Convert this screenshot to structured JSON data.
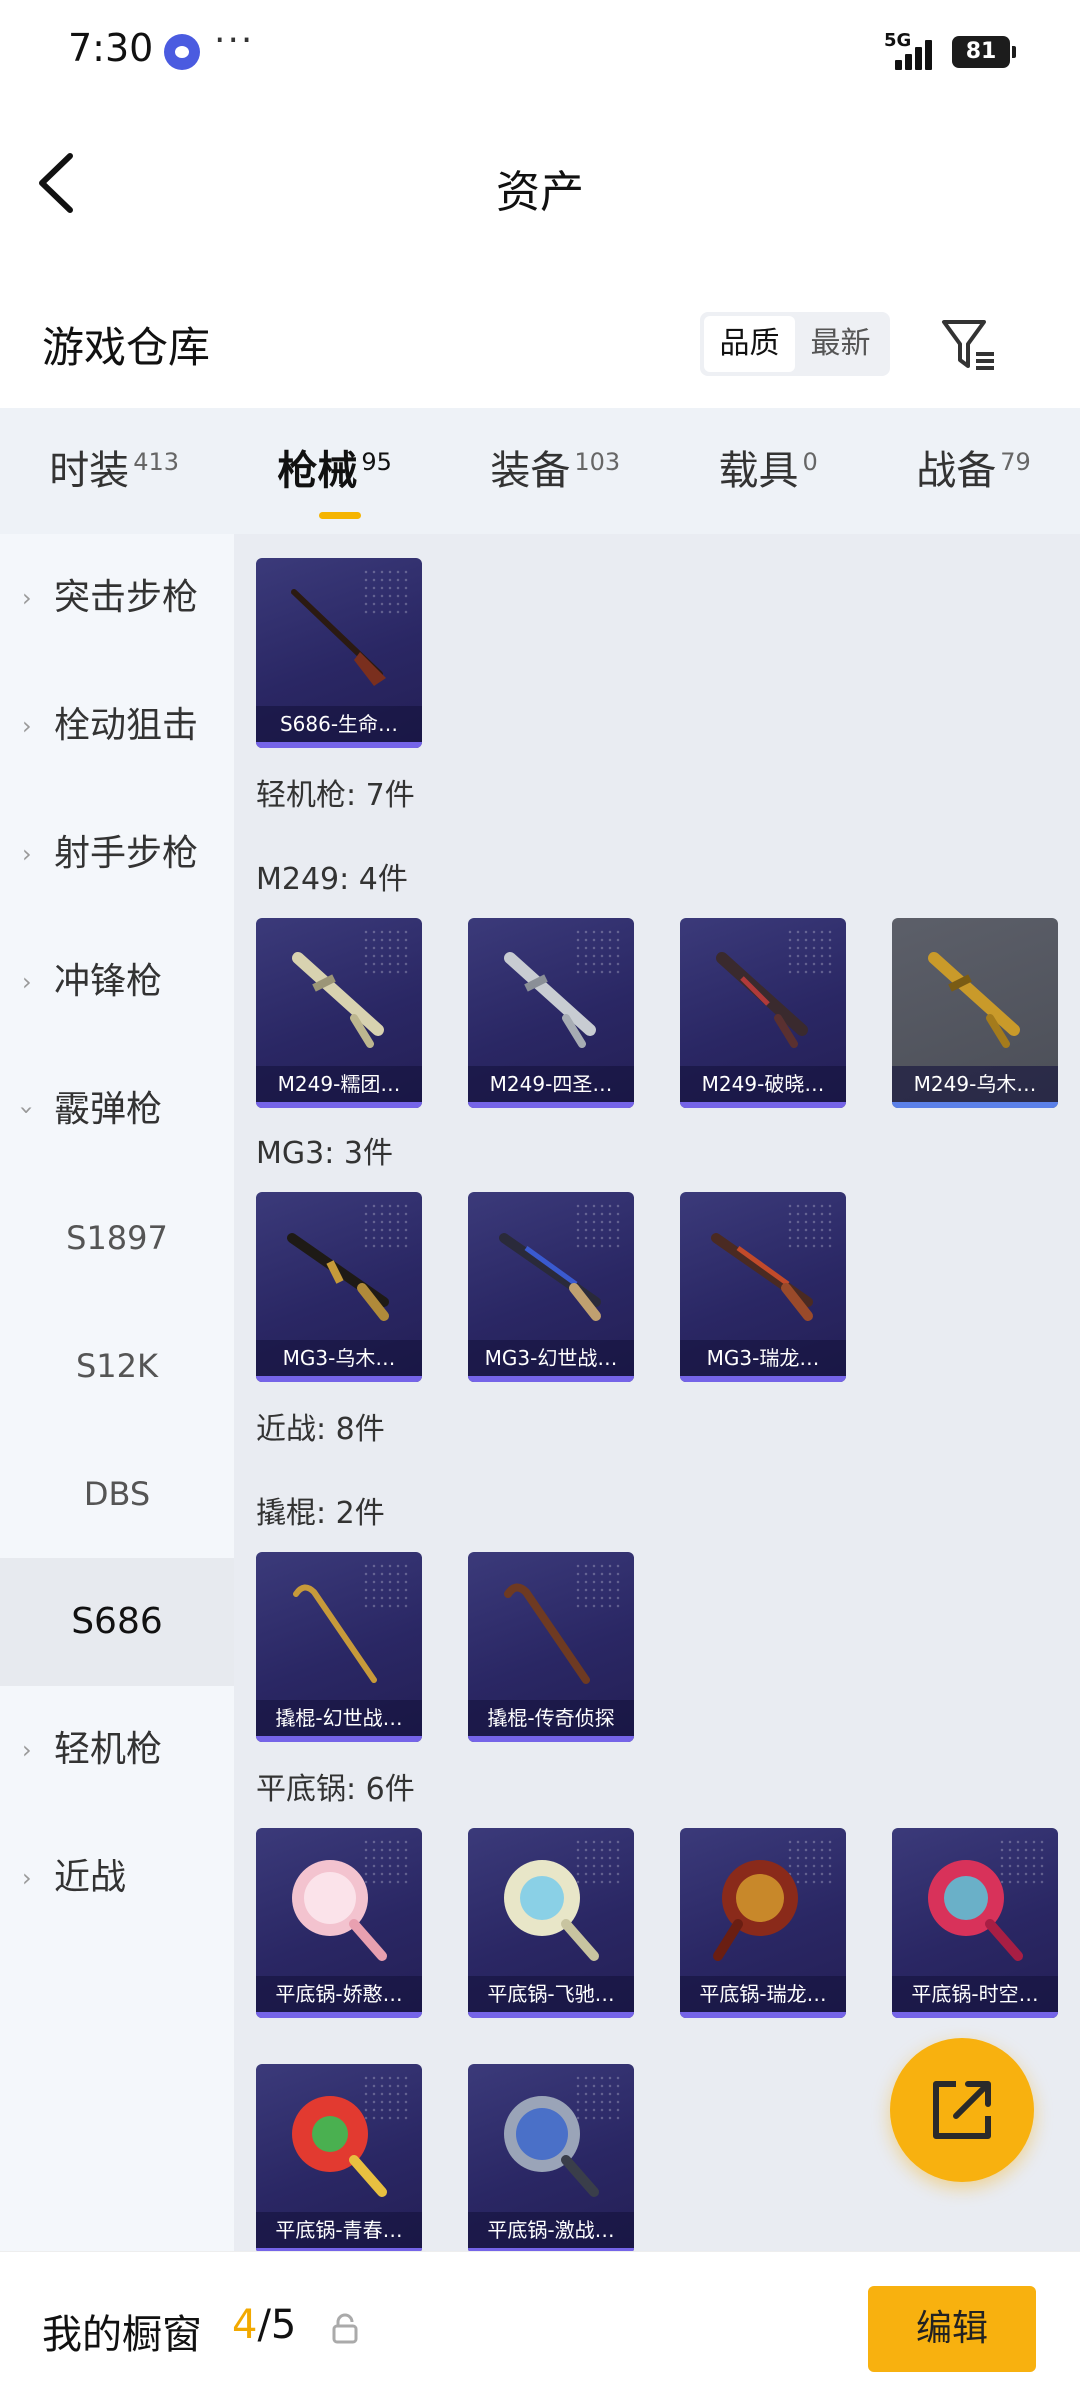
{
  "status": {
    "time": "7:30",
    "network": "5G",
    "battery": "81"
  },
  "nav": {
    "title": "资产"
  },
  "header": {
    "title": "游戏仓库",
    "sort_quality": "品质",
    "sort_newest": "最新"
  },
  "tabs": [
    {
      "label": "时装",
      "count": "413"
    },
    {
      "label": "枪械",
      "count": "95"
    },
    {
      "label": "装备",
      "count": "103"
    },
    {
      "label": "载具",
      "count": "0"
    },
    {
      "label": "战备",
      "count": "79"
    }
  ],
  "sidebar": {
    "items": [
      "突击步枪",
      "栓动狙击",
      "射手步枪",
      "冲锋枪",
      "霰弹枪"
    ],
    "subitems": [
      "S1897",
      "S12K",
      "DBS",
      "S686"
    ],
    "items2": [
      "轻机枪",
      "近战"
    ]
  },
  "content": {
    "s686_card": "S686-生命…",
    "lmg_group": "轻机枪: 7件",
    "m249_group": "M249: 4件",
    "m249": [
      "M249-糯团…",
      "M249-四圣…",
      "M249-破晓…",
      "M249-乌木…"
    ],
    "mg3_group": "MG3: 3件",
    "mg3": [
      "MG3-乌木…",
      "MG3-幻世战…",
      "MG3-瑞龙…"
    ],
    "melee_group": "近战: 8件",
    "crowbar_group": "撬棍: 2件",
    "crowbar": [
      "撬棍-幻世战…",
      "撬棍-传奇侦探"
    ],
    "pan_group": "平底锅: 6件",
    "pan": [
      "平底锅-娇憨…",
      "平底锅-飞驰…",
      "平底锅-瑞龙…",
      "平底锅-时空…",
      "平底锅-青春…",
      "平底锅-激战…"
    ]
  },
  "bottom": {
    "title": "我的橱窗",
    "used": "4",
    "total": "/5",
    "edit": "编辑"
  }
}
